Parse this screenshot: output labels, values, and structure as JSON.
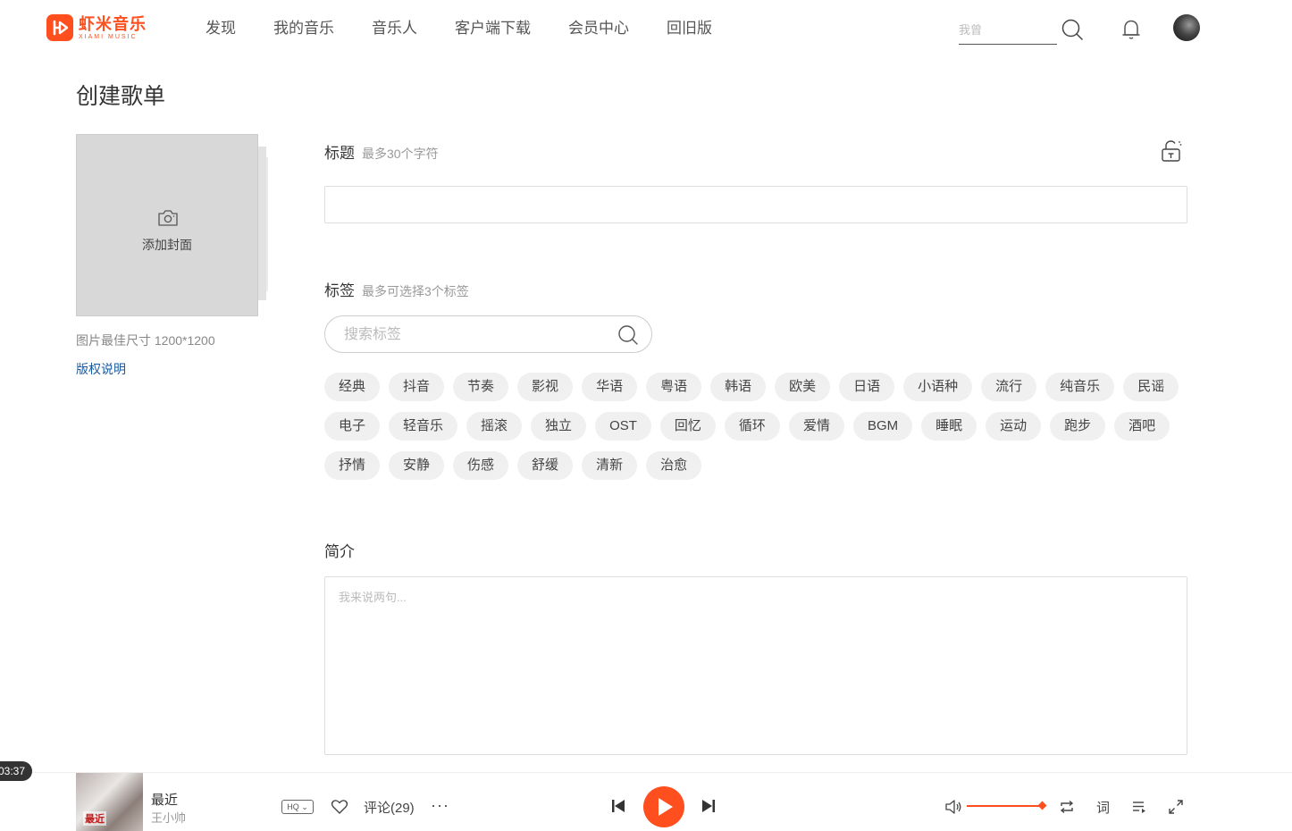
{
  "header": {
    "logo": {
      "cn": "虾米音乐",
      "en": "XIAMI MUSIC"
    },
    "nav": [
      "发现",
      "我的音乐",
      "音乐人",
      "客户端下载",
      "会员中心",
      "回旧版"
    ],
    "search": {
      "placeholder": "我曾",
      "value": ""
    }
  },
  "page": {
    "title": "创建歌单",
    "cover": {
      "label": "添加封面",
      "hint": "图片最佳尺寸 1200*1200",
      "copyright_link": "版权说明"
    },
    "title_field": {
      "label": "标题",
      "hint": "最多30个字符",
      "value": ""
    },
    "tags_field": {
      "label": "标签",
      "hint": "最多可选择3个标签",
      "search_placeholder": "搜索标签",
      "rows": [
        [
          "经典",
          "抖音",
          "节奏",
          "影视",
          "华语",
          "粤语",
          "韩语",
          "欧美",
          "日语",
          "小语种",
          "流行",
          "纯音乐",
          "民谣"
        ],
        [
          "电子",
          "轻音乐",
          "摇滚",
          "独立",
          "OST",
          "回忆",
          "循环",
          "爱情",
          "BGM",
          "睡眠",
          "运动",
          "跑步",
          "酒吧"
        ],
        [
          "抒情",
          "安静",
          "伤感",
          "舒缓",
          "清新",
          "治愈"
        ]
      ]
    },
    "description_field": {
      "label": "简介",
      "placeholder": "我来说两句..."
    }
  },
  "player": {
    "elapsed": "03:37",
    "album_text": "最近",
    "song_title": "最近",
    "artist": "王小帅",
    "quality": "HQ",
    "comments": "评论(29)",
    "more": "···",
    "lyrics": "词",
    "volume_fraction": 1.0,
    "accent_color": "#ff4f1f"
  }
}
